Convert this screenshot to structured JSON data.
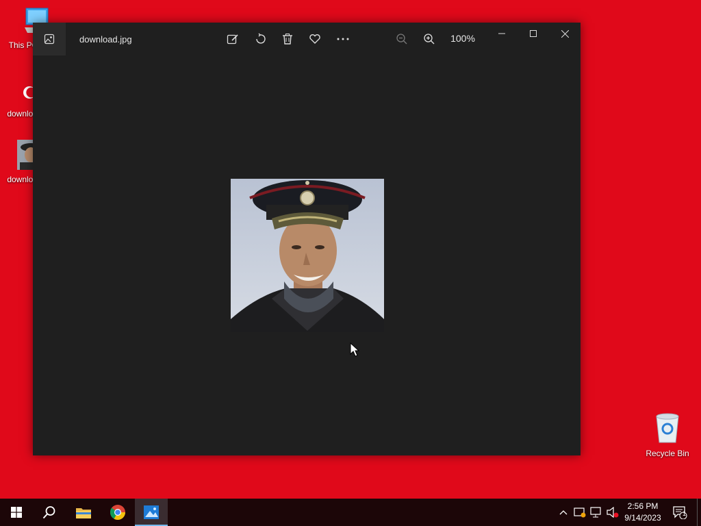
{
  "desktop": {
    "icons": [
      {
        "label": "This PC"
      },
      {
        "label": "download"
      },
      {
        "label": "download"
      },
      {
        "label": "Recycle Bin"
      }
    ]
  },
  "window": {
    "file_name": "download.jpg",
    "zoom_level": "100%",
    "toolbar": [
      "edit-image-icon",
      "rotate-icon",
      "delete-icon",
      "favorite-icon",
      "more-icon",
      "zoom-out-icon",
      "zoom-in-icon"
    ],
    "image_description_icon": "soldier-portrait-image"
  },
  "taskbar": {
    "apps": [
      "start-icon",
      "search-icon",
      "file-explorer-icon",
      "chrome-icon",
      "photos-icon"
    ],
    "tray": [
      "chevron-up-icon",
      "security-icon",
      "network-icon",
      "volume-muted-icon"
    ],
    "time": "2:56 PM",
    "date": "9/14/2023",
    "notification_count": "1"
  },
  "colors": {
    "desktop_bg": "#e0091a",
    "window_bg": "#1f1f1f",
    "taskbar_bg": "#1c0608",
    "accent": "#76b9ed"
  }
}
